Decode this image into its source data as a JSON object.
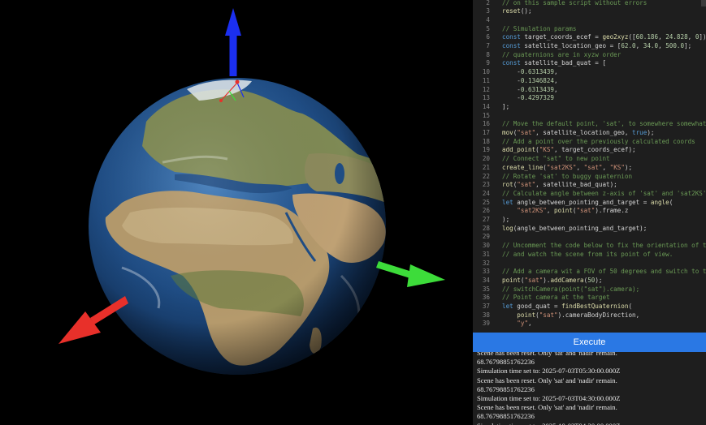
{
  "editor": {
    "lines": [
      {
        "n": "2",
        "tokens": [
          {
            "t": "// on this sample script without errors",
            "c": "cm"
          }
        ]
      },
      {
        "n": "3",
        "tokens": [
          {
            "t": "reset",
            "c": "fn"
          },
          {
            "t": "();",
            "c": ""
          }
        ]
      },
      {
        "n": "4",
        "tokens": []
      },
      {
        "n": "5",
        "tokens": [
          {
            "t": "// Simulation params",
            "c": "cm"
          }
        ]
      },
      {
        "n": "6",
        "tokens": [
          {
            "t": "const",
            "c": "kw"
          },
          {
            "t": " target_coords_ecef = ",
            "c": ""
          },
          {
            "t": "geo2xyz",
            "c": "fn"
          },
          {
            "t": "([",
            "c": ""
          },
          {
            "t": "60.186",
            "c": "num"
          },
          {
            "t": ", ",
            "c": ""
          },
          {
            "t": "24.828",
            "c": "num"
          },
          {
            "t": ", ",
            "c": ""
          },
          {
            "t": "0",
            "c": "num"
          },
          {
            "t": "]);",
            "c": ""
          }
        ]
      },
      {
        "n": "7",
        "tokens": [
          {
            "t": "const",
            "c": "kw"
          },
          {
            "t": " satellite_location_geo = [",
            "c": ""
          },
          {
            "t": "62.0",
            "c": "num"
          },
          {
            "t": ", ",
            "c": ""
          },
          {
            "t": "34.0",
            "c": "num"
          },
          {
            "t": ", ",
            "c": ""
          },
          {
            "t": "500.0",
            "c": "num"
          },
          {
            "t": "];",
            "c": ""
          }
        ]
      },
      {
        "n": "8",
        "tokens": [
          {
            "t": "// quaternions are in xyzw order",
            "c": "cm"
          }
        ]
      },
      {
        "n": "9",
        "tokens": [
          {
            "t": "const",
            "c": "kw"
          },
          {
            "t": " satellite_bad_quat = [",
            "c": ""
          }
        ]
      },
      {
        "n": "10",
        "tokens": [
          {
            "t": "    -",
            "c": ""
          },
          {
            "t": "0.6313439",
            "c": "num"
          },
          {
            "t": ",",
            "c": ""
          }
        ]
      },
      {
        "n": "11",
        "tokens": [
          {
            "t": "    -",
            "c": ""
          },
          {
            "t": "0.1346824",
            "c": "num"
          },
          {
            "t": ",",
            "c": ""
          }
        ]
      },
      {
        "n": "12",
        "tokens": [
          {
            "t": "    -",
            "c": ""
          },
          {
            "t": "0.6313439",
            "c": "num"
          },
          {
            "t": ",",
            "c": ""
          }
        ]
      },
      {
        "n": "13",
        "tokens": [
          {
            "t": "    -",
            "c": ""
          },
          {
            "t": "0.4297329",
            "c": "num"
          }
        ]
      },
      {
        "n": "14",
        "tokens": [
          {
            "t": "];",
            "c": ""
          }
        ]
      },
      {
        "n": "15",
        "tokens": []
      },
      {
        "n": "16",
        "tokens": [
          {
            "t": "// Move the default point, 'sat', to somewhere somewhat ne",
            "c": "cm"
          }
        ]
      },
      {
        "n": "17",
        "tokens": [
          {
            "t": "mov",
            "c": "fn"
          },
          {
            "t": "(",
            "c": ""
          },
          {
            "t": "\"sat\"",
            "c": "str"
          },
          {
            "t": ", satellite_location_geo, ",
            "c": ""
          },
          {
            "t": "true",
            "c": "kw"
          },
          {
            "t": ");",
            "c": ""
          }
        ]
      },
      {
        "n": "18",
        "tokens": [
          {
            "t": "// Add a point over the previously calculated coords",
            "c": "cm"
          }
        ]
      },
      {
        "n": "19",
        "tokens": [
          {
            "t": "add_point",
            "c": "fn"
          },
          {
            "t": "(",
            "c": ""
          },
          {
            "t": "\"KS\"",
            "c": "str"
          },
          {
            "t": ", target_coords_ecef);",
            "c": ""
          }
        ]
      },
      {
        "n": "20",
        "tokens": [
          {
            "t": "// Connect \"sat\" to new point",
            "c": "cm"
          }
        ]
      },
      {
        "n": "21",
        "tokens": [
          {
            "t": "create_line",
            "c": "fn"
          },
          {
            "t": "(",
            "c": ""
          },
          {
            "t": "\"sat2KS\"",
            "c": "str"
          },
          {
            "t": ", ",
            "c": ""
          },
          {
            "t": "\"sat\"",
            "c": "str"
          },
          {
            "t": ", ",
            "c": ""
          },
          {
            "t": "\"KS\"",
            "c": "str"
          },
          {
            "t": ");",
            "c": ""
          }
        ]
      },
      {
        "n": "22",
        "tokens": [
          {
            "t": "// Rotate 'sat' to buggy quaternion",
            "c": "cm"
          }
        ]
      },
      {
        "n": "23",
        "tokens": [
          {
            "t": "rot",
            "c": "fn"
          },
          {
            "t": "(",
            "c": ""
          },
          {
            "t": "\"sat\"",
            "c": "str"
          },
          {
            "t": ", satellite_bad_quat);",
            "c": ""
          }
        ]
      },
      {
        "n": "24",
        "tokens": [
          {
            "t": "// Calculate angle between z-axis of 'sat' and 'sat2KS'",
            "c": "cm"
          }
        ]
      },
      {
        "n": "25",
        "tokens": [
          {
            "t": "let",
            "c": "kw"
          },
          {
            "t": " angle_between_pointing_and_target = ",
            "c": ""
          },
          {
            "t": "angle",
            "c": "fn"
          },
          {
            "t": "(",
            "c": ""
          }
        ]
      },
      {
        "n": "26",
        "tokens": [
          {
            "t": "    ",
            "c": ""
          },
          {
            "t": "\"sat2KS\"",
            "c": "str"
          },
          {
            "t": ", ",
            "c": ""
          },
          {
            "t": "point",
            "c": "fn"
          },
          {
            "t": "(",
            "c": ""
          },
          {
            "t": "\"sat\"",
            "c": "str"
          },
          {
            "t": ").frame.z",
            "c": ""
          }
        ]
      },
      {
        "n": "27",
        "tokens": [
          {
            "t": ");",
            "c": ""
          }
        ]
      },
      {
        "n": "28",
        "tokens": [
          {
            "t": "log",
            "c": "fn"
          },
          {
            "t": "(angle_between_pointing_and_target);",
            "c": ""
          }
        ]
      },
      {
        "n": "29",
        "tokens": []
      },
      {
        "n": "30",
        "tokens": [
          {
            "t": "// Uncomment the code below to fix the orientation of the",
            "c": "cm"
          }
        ]
      },
      {
        "n": "31",
        "tokens": [
          {
            "t": "// and watch the scene from its point of view.",
            "c": "cm"
          }
        ]
      },
      {
        "n": "32",
        "tokens": []
      },
      {
        "n": "33",
        "tokens": [
          {
            "t": "// Add a camera wit a FOV of 50 degrees and switch to the",
            "c": "cm"
          }
        ]
      },
      {
        "n": "34",
        "tokens": [
          {
            "t": "point",
            "c": "fn"
          },
          {
            "t": "(",
            "c": ""
          },
          {
            "t": "\"sat\"",
            "c": "str"
          },
          {
            "t": ").",
            "c": ""
          },
          {
            "t": "addCamera",
            "c": "fn"
          },
          {
            "t": "(",
            "c": ""
          },
          {
            "t": "50",
            "c": "num"
          },
          {
            "t": ");",
            "c": ""
          }
        ]
      },
      {
        "n": "35",
        "tokens": [
          {
            "t": "// switchCamera(point(\"sat\").camera);",
            "c": "cm"
          }
        ]
      },
      {
        "n": "36",
        "tokens": [
          {
            "t": "// Point camera at the target",
            "c": "cm"
          }
        ]
      },
      {
        "n": "37",
        "tokens": [
          {
            "t": "let",
            "c": "kw"
          },
          {
            "t": " good_quat = ",
            "c": ""
          },
          {
            "t": "findBestQuaternion",
            "c": "fn"
          },
          {
            "t": "(",
            "c": ""
          }
        ]
      },
      {
        "n": "38",
        "tokens": [
          {
            "t": "    ",
            "c": ""
          },
          {
            "t": "point",
            "c": "fn"
          },
          {
            "t": "(",
            "c": ""
          },
          {
            "t": "\"sat\"",
            "c": "str"
          },
          {
            "t": ").cameraBodyDirection,",
            "c": ""
          }
        ]
      },
      {
        "n": "39",
        "tokens": [
          {
            "t": "    ",
            "c": ""
          },
          {
            "t": "\"y\"",
            "c": "str"
          },
          {
            "t": ",",
            "c": ""
          }
        ]
      }
    ]
  },
  "execute": {
    "label": "Execute"
  },
  "console": {
    "lines": [
      "Scene has been reset. Only 'sat' and 'nadir' remain.",
      "68.76798851762236",
      "Simulation time set to: 2025-07-03T05:30:00.000Z",
      "Scene has been reset. Only 'sat' and 'nadir' remain.",
      "68.76798851762236",
      "Simulation time set to: 2025-07-03T04:30:00.000Z",
      "Scene has been reset. Only 'sat' and 'nadir' remain.",
      "68.76798851762236",
      "Simulation time set to: 2025-10-03T04:30:00.000Z"
    ]
  },
  "scene": {
    "axis_colors": {
      "x": "#e8302a",
      "y": "#3ddc3a",
      "z": "#1b2ff0"
    },
    "ocean_color": "#1f4d85",
    "land_color": "#b59a6c"
  }
}
